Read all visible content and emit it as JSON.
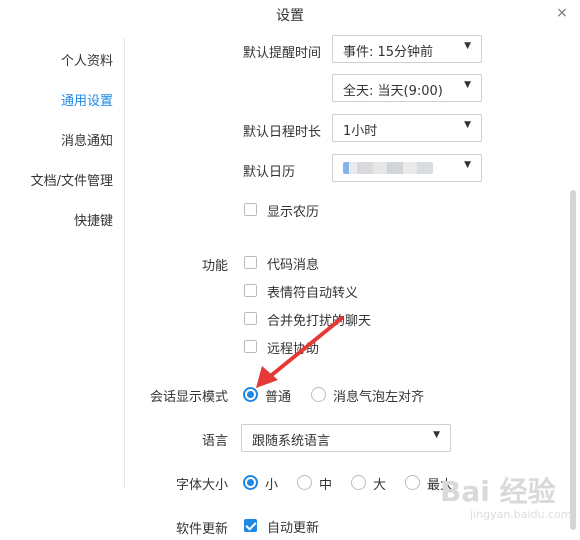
{
  "window": {
    "title": "设置",
    "close_glyph": "×"
  },
  "sidebar": {
    "items": [
      {
        "label": "个人资料",
        "active": false
      },
      {
        "label": "通用设置",
        "active": true
      },
      {
        "label": "消息通知",
        "active": false
      },
      {
        "label": "文档/文件管理",
        "active": false
      },
      {
        "label": "快捷键",
        "active": false
      }
    ]
  },
  "calendar": {
    "reminder_label": "默认提醒时间",
    "reminder_event_value": "事件: 15分钟前",
    "reminder_allday_value": "全天: 当天(9:00)",
    "duration_label": "默认日程时长",
    "duration_value": "1小时",
    "calendar_label": "默认日历",
    "calendar_value_blurred": true,
    "lunar_label": "显示农历",
    "lunar_checked": false
  },
  "features": {
    "label": "功能",
    "items": [
      {
        "label": "代码消息",
        "checked": false
      },
      {
        "label": "表情符自动转义",
        "checked": false
      },
      {
        "label": "合并免打扰的聊天",
        "checked": false
      },
      {
        "label": "远程协助",
        "checked": false
      }
    ]
  },
  "display_mode": {
    "label": "会话显示模式",
    "options": [
      {
        "label": "普通",
        "checked": true
      },
      {
        "label": "消息气泡左对齐",
        "checked": false
      }
    ]
  },
  "language": {
    "label": "语言",
    "value": "跟随系统语言"
  },
  "font_size": {
    "label": "字体大小",
    "options": [
      {
        "label": "小",
        "checked": true
      },
      {
        "label": "中",
        "checked": false
      },
      {
        "label": "大",
        "checked": false
      },
      {
        "label": "最大",
        "checked": false
      }
    ]
  },
  "update": {
    "label": "软件更新",
    "checkbox_label": "自动更新",
    "checked": true
  },
  "icons": {
    "dropdown_arrow": "▼",
    "annotation": "red-arrow-icon"
  },
  "colors": {
    "accent": "#1e88e5",
    "annotation": "#e53935"
  }
}
